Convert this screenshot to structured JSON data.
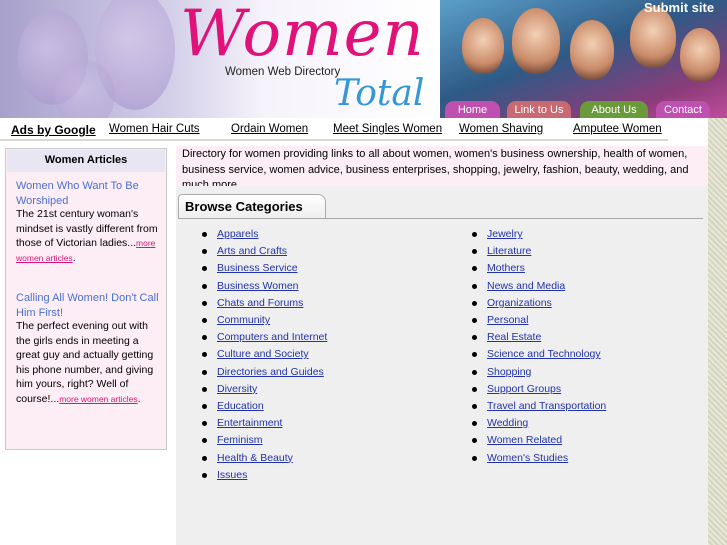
{
  "header": {
    "logo_women": "Women",
    "logo_subtitle": "Women Web Directory",
    "logo_total": "Total",
    "submit_site": "Submit site",
    "nav": [
      "Home",
      "Link to Us",
      "About Us",
      "Contact Us"
    ]
  },
  "ads": {
    "label": "Ads by Google",
    "links": [
      "Women Hair Cuts",
      "Ordain Women",
      "Meet Singles Women",
      "Women Shaving",
      "Amputee Women"
    ]
  },
  "sidebar": {
    "heading": "Women Articles",
    "articles": [
      {
        "title": "Women Who Want To Be Worshiped",
        "body": "The 21st century woman's mindset is vastly different from those of Victorian ladies...",
        "more": "more women articles"
      },
      {
        "title": "Calling All Women! Don't Call Him First!",
        "body": "The perfect evening out with the girls ends in meeting a great guy and actually getting his phone number, and giving him yours, right? Well of course!...",
        "more": "more women articles"
      }
    ]
  },
  "main": {
    "intro": "Directory for women providing links to all about women, women's business ownership, health of women, business service, women advice, business enterprises, shopping, jewelry, fashion, beauty, wedding, and much more.",
    "browse_title": "Browse Categories",
    "categories_left": [
      "Apparels",
      "Arts and Crafts",
      "Business Service",
      "Business Women",
      "Chats and Forums",
      "Community",
      "Computers and Internet",
      "Culture and Society",
      "Directories and Guides",
      "Diversity",
      "Education",
      "Entertainment",
      "Feminism",
      "Health & Beauty",
      "Issues"
    ],
    "categories_right": [
      "Jewelry",
      "Literature",
      "Mothers",
      "News and Media",
      "Organizations",
      "Personal",
      "Real Estate",
      "Science and Technology",
      "Shopping",
      "Support Groups",
      "Travel and Transportation",
      "Wedding",
      "Women Related",
      "Women's Studies"
    ]
  },
  "colors": {
    "logo_pink": "#e0127a",
    "logo_blue": "#3596d8",
    "link_blue": "#2233aa",
    "sidebar_bg": "#fdeef5"
  }
}
